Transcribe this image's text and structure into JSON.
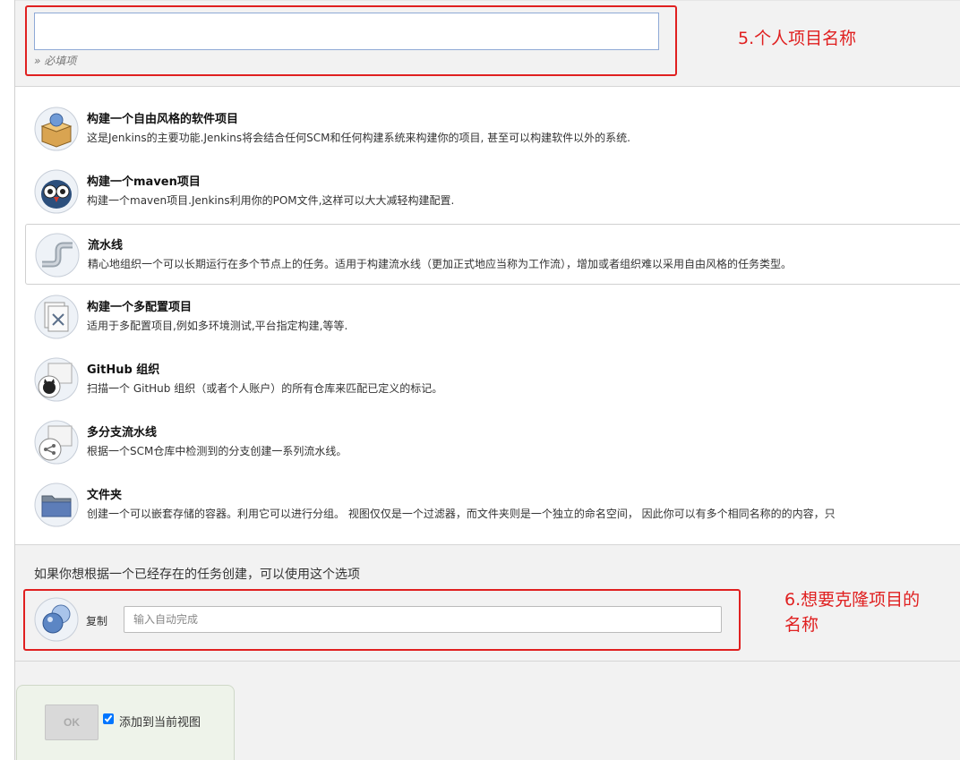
{
  "item_name": {
    "value": "",
    "hint": "» 必填项",
    "annotation": "5.个人项目名称"
  },
  "item_types": [
    {
      "title": "构建一个自由风格的软件项目",
      "desc": "这是Jenkins的主要功能.Jenkins将会结合任何SCM和任何构建系统来构建你的项目, 甚至可以构建软件以外的系统.",
      "icon": "freestyle-box-icon"
    },
    {
      "title": "构建一个maven项目",
      "desc": "构建一个maven项目.Jenkins利用你的POM文件,这样可以大大减轻构建配置.",
      "icon": "maven-owl-icon"
    },
    {
      "title": "流水线",
      "desc": "精心地组织一个可以长期运行在多个节点上的任务。适用于构建流水线（更加正式地应当称为工作流），增加或者组织难以采用自由风格的任务类型。",
      "icon": "pipeline-icon"
    },
    {
      "title": "构建一个多配置项目",
      "desc": "适用于多配置项目,例如多环境测试,平台指定构建,等等.",
      "icon": "multi-config-icon"
    },
    {
      "title": "GitHub 组织",
      "desc": "扫描一个 GitHub 组织（或者个人账户）的所有仓库来匹配已定义的标记。",
      "icon": "github-org-icon"
    },
    {
      "title": "多分支流水线",
      "desc": "根据一个SCM仓库中检测到的分支创建一系列流水线。",
      "icon": "multibranch-icon"
    },
    {
      "title": "文件夹",
      "desc": "创建一个可以嵌套存储的容器。利用它可以进行分组。 视图仅仅是一个过滤器，而文件夹则是一个独立的命名空间， 因此你可以有多个相同名称的的内容，只",
      "icon": "folder-icon"
    }
  ],
  "copy": {
    "hint": "如果你想根据一个已经存在的任务创建，可以使用这个选项",
    "label": "复制",
    "placeholder": "输入自动完成",
    "annotation_line1": "6.想要克隆项目的",
    "annotation_line2": "名称",
    "icon": "copy-icon"
  },
  "footer": {
    "ok_label": "OK",
    "add_to_view_label": "添加到当前视图",
    "add_to_view_checked": true
  },
  "colors": {
    "annotation": "#e02020",
    "input_border": "#8ea9d6"
  }
}
